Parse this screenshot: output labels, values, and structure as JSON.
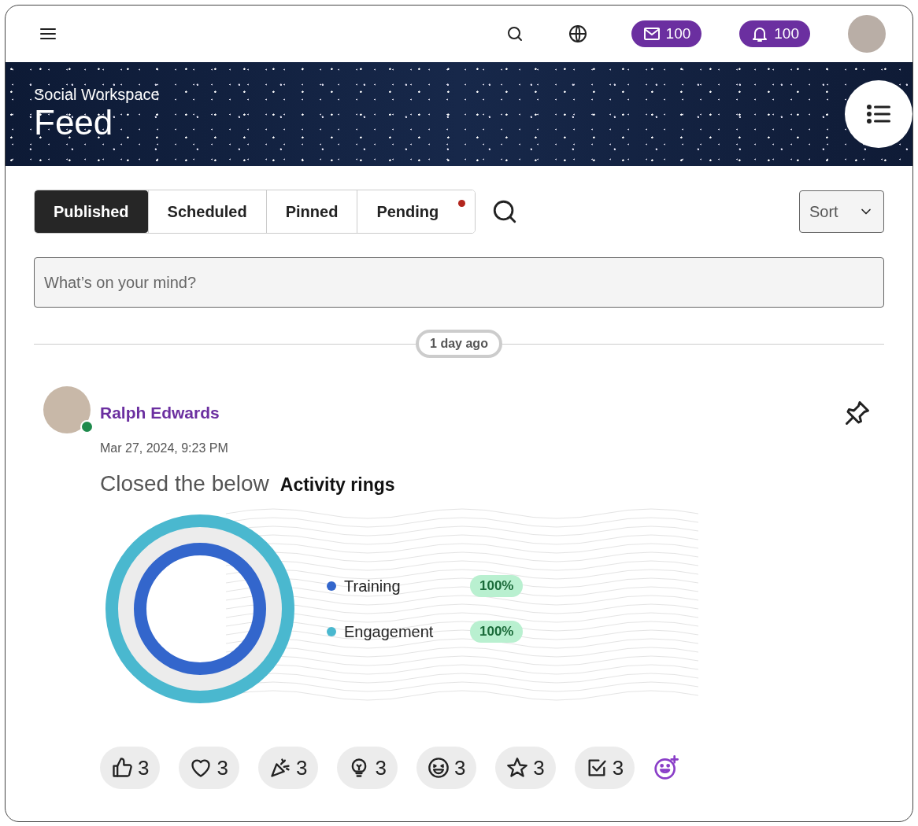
{
  "top_bar": {
    "mail_count": "100",
    "notification_count": "100"
  },
  "header": {
    "subtitle": "Social Workspace",
    "title": "Feed"
  },
  "tabs": [
    {
      "label": "Published",
      "selected": true,
      "has_dot": false
    },
    {
      "label": "Scheduled",
      "selected": false,
      "has_dot": false
    },
    {
      "label": "Pinned",
      "selected": false,
      "has_dot": false
    },
    {
      "label": "Pending",
      "selected": false,
      "has_dot": true
    }
  ],
  "sort": {
    "label": "Sort"
  },
  "composer": {
    "placeholder": "What’s on your mind?"
  },
  "divider_label": "1 day ago",
  "post": {
    "author": "Ralph Edwards",
    "online": true,
    "timestamp": "Mar 27, 2024, 9:23 PM",
    "text": "Closed the below",
    "highlight": "Activity rings",
    "pinned": true,
    "rings": [
      {
        "name": "Training",
        "color": "#3366cc",
        "level": 1,
        "reading": "100%"
      },
      {
        "name": "Engagement",
        "color": "#4ab8cf",
        "level": 1,
        "reading": "100%"
      }
    ],
    "reactions": [
      {
        "kind": "like",
        "count": "3"
      },
      {
        "kind": "heart",
        "count": "3"
      },
      {
        "kind": "party",
        "count": "3"
      },
      {
        "kind": "idea",
        "count": "3"
      },
      {
        "kind": "laugh",
        "count": "3"
      },
      {
        "kind": "star",
        "count": "3"
      },
      {
        "kind": "check",
        "count": "3"
      }
    ]
  }
}
